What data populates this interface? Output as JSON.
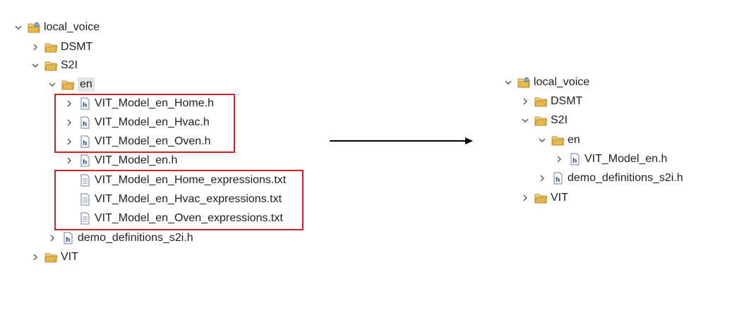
{
  "left_tree": [
    {
      "label": "local_voice",
      "icon": "project-folder-icon",
      "chevron": "down",
      "selected": false
    },
    {
      "label": "DSMT",
      "icon": "folder-open-icon",
      "chevron": "right",
      "selected": false
    },
    {
      "label": "S2I",
      "icon": "folder-open-icon",
      "chevron": "down",
      "selected": false
    },
    {
      "label": "en",
      "icon": "folder-open-icon",
      "chevron": "down",
      "selected": true
    },
    {
      "label": "VIT_Model_en_Home.h",
      "icon": "header-file-icon",
      "chevron": "right",
      "selected": false
    },
    {
      "label": "VIT_Model_en_Hvac.h",
      "icon": "header-file-icon",
      "chevron": "right",
      "selected": false
    },
    {
      "label": "VIT_Model_en_Oven.h",
      "icon": "header-file-icon",
      "chevron": "right",
      "selected": false
    },
    {
      "label": "VIT_Model_en.h",
      "icon": "header-file-icon",
      "chevron": "right",
      "selected": false
    },
    {
      "label": "VIT_Model_en_Home_expressions.txt",
      "icon": "text-file-icon",
      "chevron": "none",
      "selected": false
    },
    {
      "label": "VIT_Model_en_Hvac_expressions.txt",
      "icon": "text-file-icon",
      "chevron": "none",
      "selected": false
    },
    {
      "label": "VIT_Model_en_Oven_expressions.txt",
      "icon": "text-file-icon",
      "chevron": "none",
      "selected": false
    },
    {
      "label": "demo_definitions_s2i.h",
      "icon": "header-file-icon",
      "chevron": "right",
      "selected": false
    },
    {
      "label": "VIT",
      "icon": "folder-open-icon",
      "chevron": "right",
      "selected": false
    }
  ],
  "right_tree": [
    {
      "label": "local_voice",
      "icon": "project-folder-icon",
      "chevron": "down"
    },
    {
      "label": "DSMT",
      "icon": "folder-open-icon",
      "chevron": "right"
    },
    {
      "label": "S2I",
      "icon": "folder-open-icon",
      "chevron": "down"
    },
    {
      "label": "en",
      "icon": "folder-open-icon",
      "chevron": "down"
    },
    {
      "label": "VIT_Model_en.h",
      "icon": "header-file-icon",
      "chevron": "right"
    },
    {
      "label": "demo_definitions_s2i.h",
      "icon": "header-file-icon",
      "chevron": "right"
    },
    {
      "label": "VIT",
      "icon": "folder-open-icon",
      "chevron": "right"
    }
  ],
  "colors": {
    "highlight_box": "#d11f26",
    "arrow": "#000000",
    "folder": "#e8b64a",
    "selection": "#e5e5e5"
  }
}
